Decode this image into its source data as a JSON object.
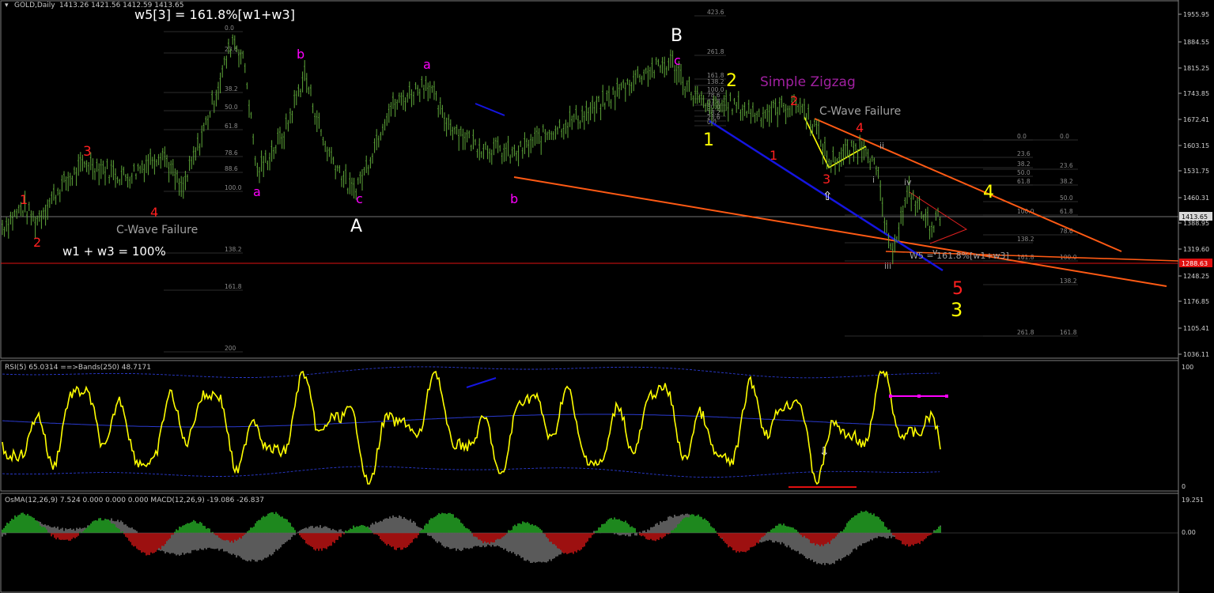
{
  "window": {
    "title": "GOLD,Daily",
    "ohlc": "1413.26 1421.56 1412.59 1413.65",
    "title_glyph": "▾"
  },
  "main_panel": {
    "price_axis": [
      "1955.95",
      "1884.55",
      "1815.25",
      "1743.85",
      "1672.41",
      "1603.15",
      "1531.75",
      "1460.31",
      "1388.95",
      "1319.60",
      "1248.25",
      "1176.85",
      "1105.41",
      "1036.11"
    ],
    "current_price_label": "1413.65",
    "support_price_label": "1288.63"
  },
  "annotations": {
    "main": [
      {
        "text": "w5[3] = 161.8%[w1+w3]",
        "color": "#ffffff"
      },
      {
        "text": "C-Wave Failure",
        "color": "#a0a0a0"
      },
      {
        "text": "w1 + w3 = 100%",
        "color": "#ffffff"
      },
      {
        "text": "B",
        "color": "#ffffff"
      },
      {
        "text": "A",
        "color": "#ffffff"
      },
      {
        "text": "Simple Zigzag",
        "color": "#a020a0"
      },
      {
        "text": "C-Wave Failure",
        "color": "#a0a0a0"
      },
      {
        "text": "W5 = 161.8%[w1+w3]",
        "color": "#a0a0a0"
      }
    ],
    "wave_labels": [
      {
        "text": "1",
        "color": "#ff2020"
      },
      {
        "text": "2",
        "color": "#ff2020"
      },
      {
        "text": "3",
        "color": "#ff2020"
      },
      {
        "text": "4",
        "color": "#ff2020"
      },
      {
        "text": "a",
        "color": "#ff00ff"
      },
      {
        "text": "b",
        "color": "#ff00ff"
      },
      {
        "text": "a",
        "color": "#ff00ff"
      },
      {
        "text": "c",
        "color": "#ff00ff"
      },
      {
        "text": "a",
        "color": "#ff00ff"
      },
      {
        "text": "b",
        "color": "#ff00ff"
      },
      {
        "text": "c",
        "color": "#ff00ff"
      },
      {
        "text": "1",
        "color": "#ffff00"
      },
      {
        "text": "2",
        "color": "#ffff00"
      },
      {
        "text": "2",
        "color": "#ff2020"
      },
      {
        "text": "1",
        "color": "#ff2020"
      },
      {
        "text": "4",
        "color": "#ff2020"
      },
      {
        "text": "3",
        "color": "#ff2020"
      },
      {
        "text": "4",
        "color": "#ffff00"
      },
      {
        "text": "5",
        "color": "#ff2020"
      },
      {
        "text": "3",
        "color": "#ffff00"
      },
      {
        "text": "i",
        "color": "#a0a0a0"
      },
      {
        "text": "ii",
        "color": "#a0a0a0"
      },
      {
        "text": "iii",
        "color": "#a0a0a0"
      },
      {
        "text": "iv",
        "color": "#a0a0a0"
      },
      {
        "text": "v",
        "color": "#a0a0a0"
      }
    ],
    "arrows": [
      "⇧",
      "⇩"
    ]
  },
  "fib_levels": {
    "left": [
      "0.0",
      "23.6",
      "38.2",
      "50.0",
      "61.8",
      "78.6",
      "88.6",
      "100.0",
      "138.2",
      "161.8",
      "200"
    ],
    "middle": [
      "423.6",
      "261.8",
      "161.8",
      "138.2",
      "100.0",
      "78.6",
      "61.8",
      "50.0",
      "38.2",
      "23.6",
      "0.0"
    ],
    "right_a": [
      "0.0",
      "23.6",
      "38.2",
      "50.0",
      "61.8",
      "100.0",
      "138.2",
      "161.8",
      "261.8"
    ],
    "right_b": [
      "0.0",
      "23.6",
      "38.2",
      "50.0",
      "61.8",
      "78.6",
      "100.0",
      "138.2",
      "161.8"
    ]
  },
  "rsi_panel": {
    "header": "RSI(5) 65.0314  ==>Bands(250) 48.7171",
    "axis": [
      "100",
      "0"
    ]
  },
  "macd_panel": {
    "header": "OsMA(12,26,9) 7.524 0.000 0.000 0.000  MACD(12,26,9) -19.086 -26.837",
    "axis": [
      "19.251",
      "0.00"
    ]
  },
  "chart_data": [
    {
      "type": "line",
      "title": "GOLD,Daily",
      "series": [
        {
          "name": "GOLD",
          "values": [
            1380,
            1440,
            1400,
            1490,
            1560,
            1520,
            1590,
            1480,
            1600,
            1760,
            1900,
            1820,
            1530,
            1640,
            1800,
            1610,
            1480,
            1530,
            1700,
            1780,
            1680,
            1610,
            1580,
            1650,
            1700,
            1800,
            1830,
            1760,
            1700,
            1720,
            1690,
            1720,
            1660,
            1560,
            1610,
            1520,
            1310,
            1480,
            1390,
            1413.65
          ]
        }
      ],
      "ylim": [
        1036.11,
        1955.95
      ]
    },
    {
      "type": "line",
      "title": "RSI(5)",
      "series": [
        {
          "name": "RSI(5)",
          "values": [
            65.03
          ]
        },
        {
          "name": "Bands(250)",
          "values": [
            48.72
          ]
        }
      ],
      "ylim": [
        0,
        100
      ]
    },
    {
      "type": "bar",
      "title": "OsMA(12,26,9)",
      "series": [
        {
          "name": "OsMA",
          "values": [
            7.524
          ]
        },
        {
          "name": "MACD",
          "values": [
            -19.086,
            -26.837
          ]
        }
      ],
      "ylim": [
        -30,
        19.251
      ]
    }
  ]
}
